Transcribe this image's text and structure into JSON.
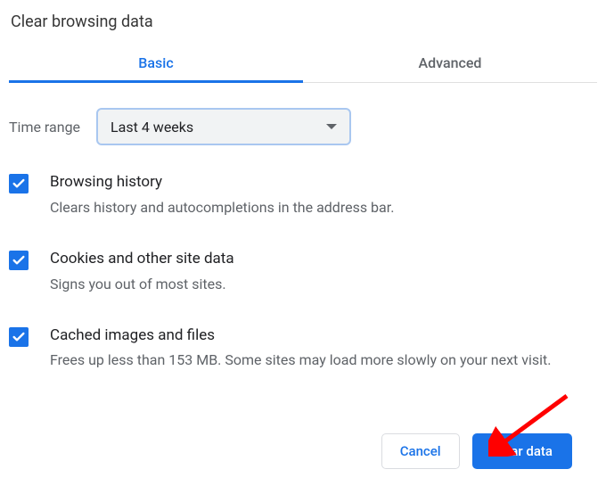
{
  "dialog": {
    "title": "Clear browsing data"
  },
  "tabs": {
    "basic": "Basic",
    "advanced": "Advanced"
  },
  "time_range": {
    "label": "Time range",
    "selected": "Last 4 weeks"
  },
  "options": [
    {
      "title": "Browsing history",
      "desc": "Clears history and autocompletions in the address bar."
    },
    {
      "title": "Cookies and other site data",
      "desc": "Signs you out of most sites."
    },
    {
      "title": "Cached images and files",
      "desc": "Frees up less than 153 MB. Some sites may load more slowly on your next visit."
    }
  ],
  "buttons": {
    "cancel": "Cancel",
    "clear": "Clear data"
  }
}
